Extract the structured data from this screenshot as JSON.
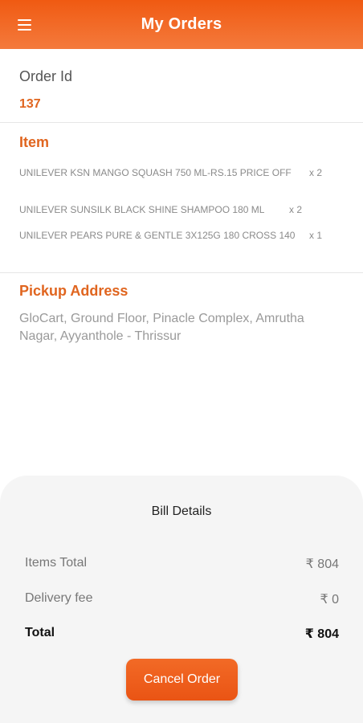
{
  "header": {
    "title": "My Orders",
    "menu_icon": "hamburger-menu-icon"
  },
  "order": {
    "label": "Order Id",
    "id": "137"
  },
  "items": {
    "heading": "Item",
    "list": [
      {
        "name": "UNILEVER KSN MANGO SQUASH 750 ML-RS.15 PRICE OFF",
        "qty": "x 2"
      },
      {
        "name": "UNILEVER SUNSILK BLACK SHINE SHAMPOO 180 ML",
        "qty": "x 2"
      },
      {
        "name": "UNILEVER PEARS PURE & GENTLE 3X125G 180 CROSS 140",
        "qty": "x 1"
      }
    ]
  },
  "pickup": {
    "heading": "Pickup Address",
    "address": "GloCart, Ground Floor, Pinacle Complex, Amrutha Nagar, Ayyanthole - Thrissur"
  },
  "bill": {
    "title": "Bill Details",
    "items_total_label": "Items Total",
    "items_total_value": "₹ 804",
    "delivery_label": "Delivery fee",
    "delivery_value": "₹ 0",
    "total_label": "Total",
    "total_value": "₹ 804"
  },
  "actions": {
    "cancel_label": "Cancel Order"
  },
  "colors": {
    "accent": "#f05a12",
    "heading": "#e0651f"
  }
}
